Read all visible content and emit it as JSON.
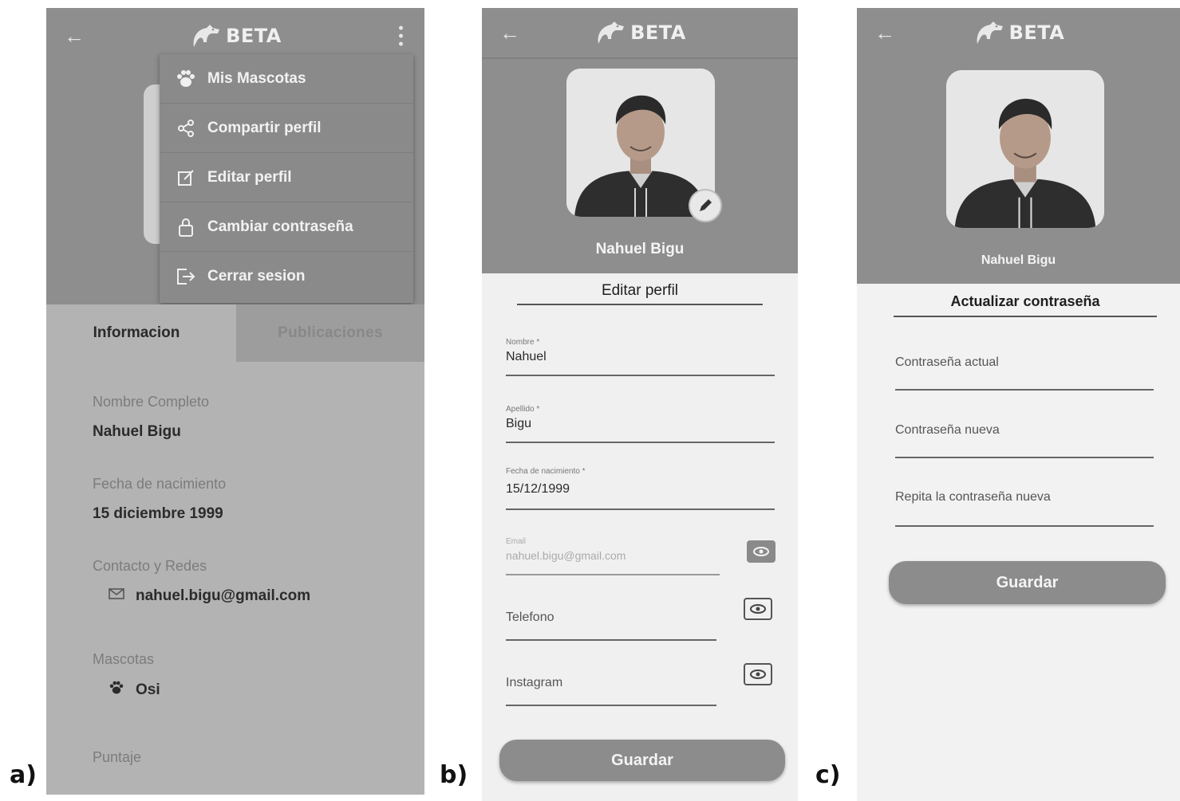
{
  "labels": {
    "a": "a)",
    "b": "b)",
    "c": "c)"
  },
  "app": {
    "brand": "BETA"
  },
  "panel_a": {
    "menu": [
      {
        "label": "Mis Mascotas",
        "icon": "paw-icon"
      },
      {
        "label": "Compartir perfil",
        "icon": "share-icon"
      },
      {
        "label": "Editar perfil",
        "icon": "edit-icon"
      },
      {
        "label": "Cambiar contraseña",
        "icon": "lock-icon"
      },
      {
        "label": "Cerrar sesion",
        "icon": "logout-icon"
      }
    ],
    "tabs": {
      "info": "Informacion",
      "publications": "Publicaciones"
    },
    "info": {
      "name_label": "Nombre Completo",
      "name_value": "Nahuel Bigu",
      "birth_label": "Fecha de nacimiento",
      "birth_value": "15 diciembre 1999",
      "contact_label": "Contacto y Redes",
      "email": "nahuel.bigu@gmail.com",
      "pets_label": "Mascotas",
      "pet_name": "Osi",
      "score_label": "Puntaje"
    }
  },
  "panel_b": {
    "profile_name": "Nahuel Bigu",
    "title": "Editar perfil",
    "fields": {
      "nombre": {
        "label": "Nombre *",
        "value": "Nahuel"
      },
      "apellido": {
        "label": "Apellido *",
        "value": "Bigu"
      },
      "fecha": {
        "label": "Fecha de nacimiento *",
        "value": "15/12/1999"
      },
      "email": {
        "label": "Email",
        "value": "nahuel.bigu@gmail.com"
      },
      "telefono": {
        "placeholder": "Telefono"
      },
      "instagram": {
        "placeholder": "Instagram"
      }
    },
    "save": "Guardar"
  },
  "panel_c": {
    "profile_name": "Nahuel Bigu",
    "title": "Actualizar contraseña",
    "fields": {
      "current": "Contraseña actual",
      "new": "Contraseña nueva",
      "repeat": "Repita la contraseña nueva"
    },
    "save": "Guardar"
  }
}
